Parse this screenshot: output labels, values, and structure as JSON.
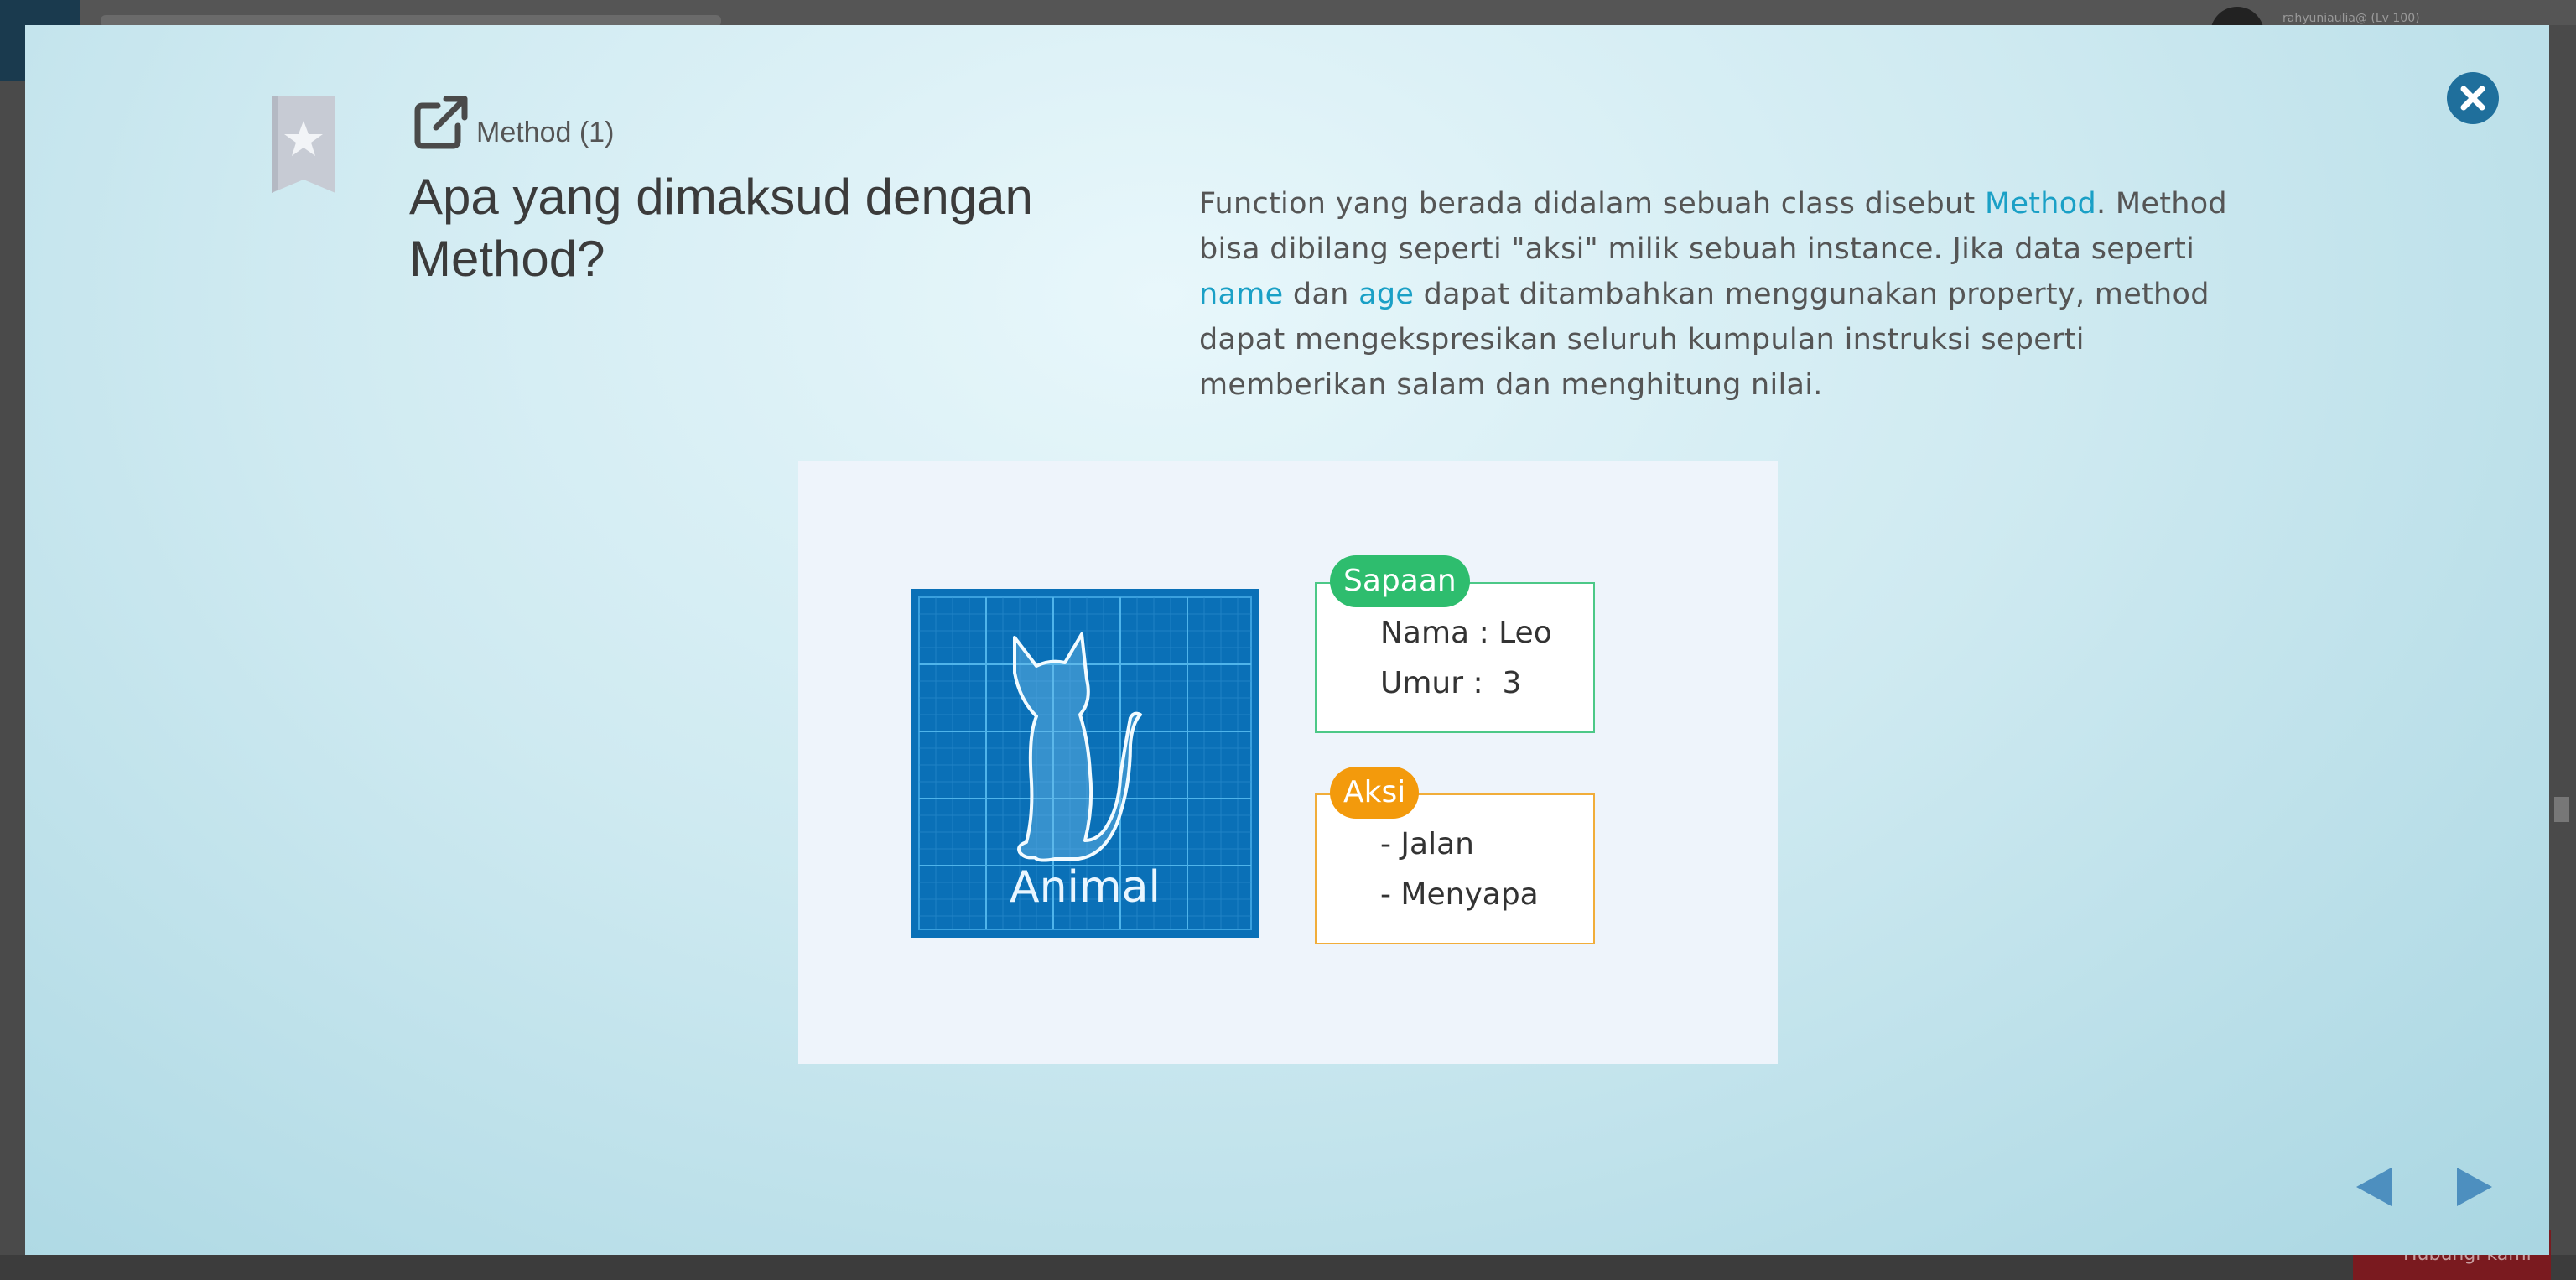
{
  "background": {
    "username": "rahyuniaulia@ (Lv 100)",
    "bottom_button_label": "Hubungi kami"
  },
  "modal": {
    "lesson_tag": "Method (1)",
    "question": "Apa yang dimaksud dengan Method?",
    "explanation": {
      "part1": "Function yang berada didalam sebuah class disebut ",
      "hl1": "Method",
      "part2": ". Method bisa dibilang seperti \"aksi\" milik sebuah instance. Jika data seperti ",
      "hl2": "name",
      "part3": " dan ",
      "hl3": "age",
      "part4": " dapat ditambahkan menggunakan property, method dapat mengekspresikan seluruh kumpulan instruksi seperti memberikan salam dan menghitung nilai."
    },
    "figure": {
      "animal_label": "Animal",
      "property_box": {
        "badge": "Sapaan",
        "lines": [
          "Nama : Leo",
          "Umur :  3"
        ]
      },
      "method_box": {
        "badge": "Aksi",
        "lines": [
          "- Jalan",
          "- Menyapa"
        ]
      }
    },
    "icons": {
      "bookmark": "star-bookmark-icon",
      "lesson": "external-link-icon",
      "close": "close-icon",
      "prev": "triangle-left-icon",
      "next": "triangle-right-icon"
    },
    "colors": {
      "highlight": "#1aa0c6",
      "close_button": "#1f6f9c",
      "property_green": "#2ebd6e",
      "method_orange": "#f39a0c",
      "blueprint": "#0a70b7"
    }
  }
}
